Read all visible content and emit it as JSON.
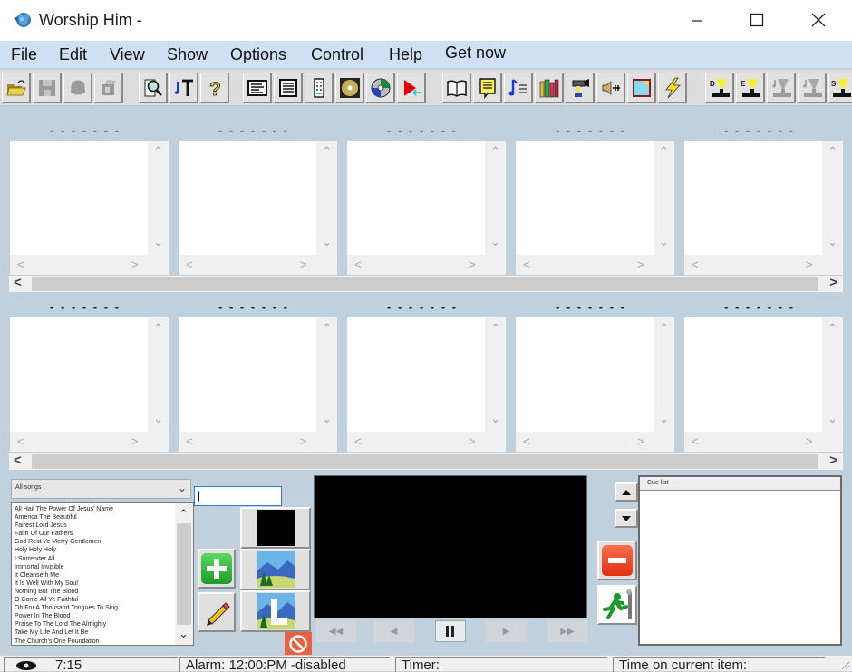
{
  "window": {
    "title": "Worship Him -",
    "controls": {
      "minimize": "minimize",
      "maximize": "maximize",
      "close": "close"
    }
  },
  "menu": {
    "items": [
      "File",
      "Edit",
      "View",
      "Show",
      "Options",
      "Control",
      "Help",
      "Get now"
    ]
  },
  "toolbar": {
    "buttons": [
      {
        "icon": "open-folder-icon",
        "enabled": true
      },
      {
        "icon": "save-disk-icon",
        "enabled": false
      },
      {
        "icon": "stamp-icon",
        "enabled": false
      },
      {
        "icon": "projector-icon",
        "enabled": false
      },
      {
        "icon": "search-document-icon",
        "enabled": true
      },
      {
        "icon": "music-text-icon",
        "enabled": true
      },
      {
        "icon": "help-question-icon",
        "enabled": true
      },
      {
        "icon": "text-box-icon",
        "enabled": true
      },
      {
        "icon": "text-lines-icon",
        "enabled": true
      },
      {
        "icon": "remote-control-icon",
        "enabled": true
      },
      {
        "icon": "gold-disc-icon",
        "enabled": true
      },
      {
        "icon": "cd-disc-icon",
        "enabled": true
      },
      {
        "icon": "play-arrow-icon",
        "enabled": true
      },
      {
        "icon": "bible-book-icon",
        "enabled": true
      },
      {
        "icon": "notes-speech-icon",
        "enabled": true
      },
      {
        "icon": "music-list-icon",
        "enabled": true
      },
      {
        "icon": "books-icon",
        "enabled": true
      },
      {
        "icon": "video-camera-icon",
        "enabled": true
      },
      {
        "icon": "speaker-icon",
        "enabled": true
      },
      {
        "icon": "sticky-note-icon",
        "enabled": true
      },
      {
        "icon": "lightning-icon",
        "enabled": true
      },
      {
        "icon": "spotlight-d-icon",
        "label": "D",
        "enabled": true
      },
      {
        "icon": "spotlight-e-icon",
        "label": "E",
        "enabled": true
      },
      {
        "icon": "spotlight-music-icon",
        "enabled": false
      },
      {
        "icon": "spotlight-music-icon",
        "enabled": false
      },
      {
        "icon": "spotlight-s-icon",
        "label": "S",
        "enabled": true
      }
    ]
  },
  "panels": {
    "row1": [
      {
        "label": "- - - - - - -"
      },
      {
        "label": "- - - - - - -"
      },
      {
        "label": "- - - - - - -"
      },
      {
        "label": "- - - - - - -"
      },
      {
        "label": "- - - - - - -"
      }
    ],
    "row2": [
      {
        "label": "- - - - - - -"
      },
      {
        "label": "- - - - - - -"
      },
      {
        "label": "- - - - - - -"
      },
      {
        "label": "- - - - - - -"
      },
      {
        "label": "- - - - - - -"
      }
    ]
  },
  "song_library": {
    "filter": "All songs",
    "search_value": "|",
    "songs": [
      "All Hail The Power Of Jesus' Name",
      "America The Beautiful",
      "Fairest Lord Jesus",
      "Faith Of Our Fathers",
      "God Rest Ye Merry Gentlemen",
      "Holy Holy Holy",
      "I Surrender All",
      "Immortal Invisible",
      "It Cleanseth Me",
      "It Is Well With My Soul",
      "Nothing But The Blood",
      "O Come All Ye Faithful",
      "Oh For A Thousand Tongues To Sing",
      "Power In The Blood",
      "Praise To The Lord The Almighty",
      "Take My Life And Let It Be",
      "The Church's One Foundation"
    ]
  },
  "cue_list": {
    "header": "Cue list",
    "items": []
  },
  "status_bar": {
    "clock": "7:15",
    "alarm": "Alarm: 12:00:PM -disabled",
    "timer": "Timer:",
    "time_on_item": "Time on current item:"
  },
  "colors": {
    "background": "#c1d0dd",
    "menubar": "#cfe0f5",
    "preview": "#000000",
    "add_green": "#2fb43a",
    "remove_red": "#e9452b"
  }
}
